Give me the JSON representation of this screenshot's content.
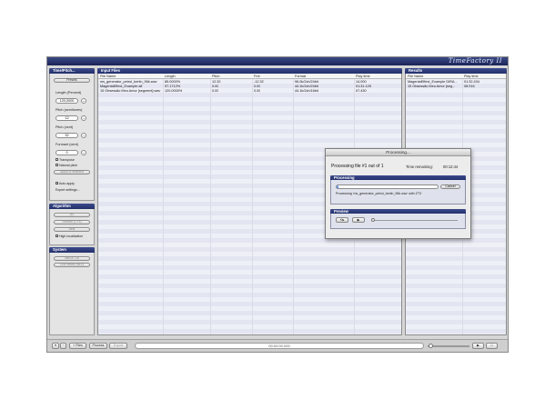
{
  "app": {
    "title": "TimeFactory II"
  },
  "left": {
    "time_pitch": {
      "header": "Time/Pitch...",
      "preset": "Presets",
      "length_label": "Length (Percent)",
      "length_value": "120,0000",
      "pitch_semi_label": "Pitch (semitones)",
      "pitch_semi_value": "12",
      "pitch_cent_label": "Pitch (cent)",
      "pitch_cent_value": "32",
      "formant_label": "Formant (cent)",
      "formant_value": "0",
      "transpose": "Transpose",
      "natural_pitch": "Natural pitch",
      "apply_selected": "Apply to selected",
      "auto_apply": "Auto apply",
      "expert_settings": "Expert settings..."
    },
    "algorithm": {
      "header": "Algorithm",
      "items": [
        "(P)",
        "Smooth (C+4)",
        "Best"
      ],
      "high_localization": "High localization"
    },
    "system": {
      "header": "System",
      "items": [
        "MBDE Lib",
        "CBz MBMD 8814"
      ]
    }
  },
  "input_files": {
    "header": "Input Files",
    "columns": [
      "File Name",
      "Length",
      "Pitch",
      "Fmt",
      "Format",
      "Play time"
    ],
    "rows": [
      [
        "ms_generator_petrol_berlin_96k.wav",
        "85.0000%",
        "12.32",
        "-12.32",
        "96.0k/2ch/24bit",
        "14.000"
      ],
      [
        "MagentaEffect_Example.aif",
        "97.1712%",
        "0.00",
        "0.00",
        "44.1k/2ch/24bit",
        "01:31.125"
      ],
      [
        "15 Obsessão Meu Amor [segment].wav",
        "120.0000%",
        "0.00",
        "0.00",
        "44.1k/2ch/16bit",
        "07.430"
      ]
    ]
  },
  "results": {
    "header": "Results",
    "columns": [
      "File Name",
      "Play time"
    ],
    "rows": [
      [
        "MagentaEffect_Example DIRA...",
        "01:32.434"
      ],
      [
        "15 Obsessão Meu Amor [seg...",
        "08.916"
      ]
    ]
  },
  "bottom": {
    "add_files": "+ Files",
    "process": "Process",
    "export": "Export",
    "time": "00:00:00.000"
  },
  "dialog": {
    "title": "Processing...",
    "status": "Processing file #1 out of 1",
    "remaining_label": "Time remaining:",
    "remaining": "00:12:44",
    "section_processing": "Processing",
    "progress": 0.02,
    "cancel": "Cancel",
    "message": "Processing 'ms_generator_petrol_berlin_96k.wav' with ZTX",
    "section_preview": "Preview",
    "btn_loop": "⟲▸",
    "btn_play": "▶"
  },
  "colors": {
    "accent": "#23306b",
    "panel": "#eef0f7",
    "chrome": "#d6d6d6"
  }
}
